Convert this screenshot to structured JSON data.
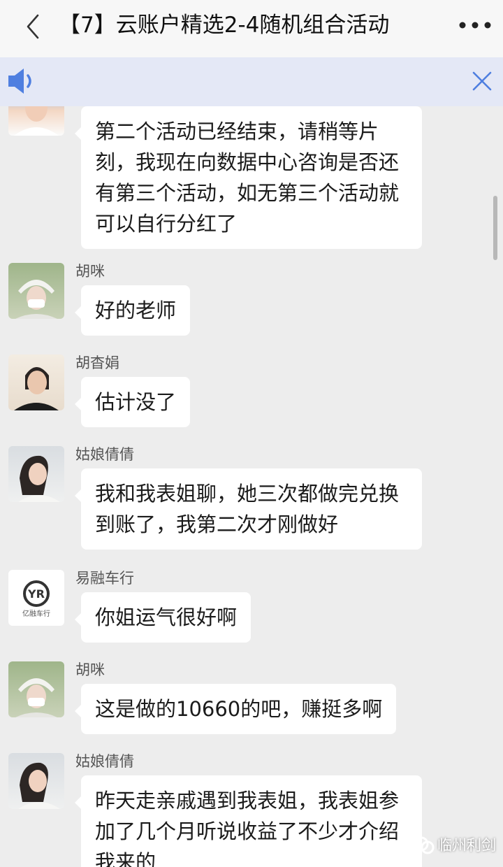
{
  "header": {
    "title": "【7】云账户精选2-4随机组合活动",
    "back_icon": "chevron-left-icon",
    "more_icon": "more-dots-icon"
  },
  "notice_bar": {
    "icon": "speaker-icon",
    "close_icon": "close-icon",
    "color": "#e4e8f6"
  },
  "messages": [
    {
      "sender": "",
      "lines": [
        "第二个活动已经结束，请稍等片",
        "刻，我现在向数据中心咨询是否还",
        "有第三个活动，如无第三个活动就",
        "可以自行分红了"
      ]
    },
    {
      "sender": "胡咪",
      "lines": [
        "好的老师"
      ]
    },
    {
      "sender": "胡杳娟",
      "lines": [
        "估计没了"
      ]
    },
    {
      "sender": "姑娘倩倩",
      "lines": [
        "我和我表姐聊，她三次都做完兑换",
        "到账了，我第二次才刚做好"
      ]
    },
    {
      "sender": "易融车行",
      "avatar_logo": "亿融车行",
      "lines": [
        "你姐运气很好啊"
      ]
    },
    {
      "sender": "胡咪",
      "lines": [
        "这是做的10660的吧，赚挺多啊"
      ]
    },
    {
      "sender": "姑娘倩倩",
      "lines": [
        "昨天走亲戚遇到我表姐，我表姐参",
        "加了几个月听说收益了不少才介绍",
        "我来的"
      ]
    }
  ],
  "watermark": {
    "icon": "wechat-channel-icon",
    "text": "临州利剑"
  },
  "colors": {
    "chat_background": "#ededed",
    "bubble": "#ffffff",
    "title_bar": "#f7f7f7"
  }
}
